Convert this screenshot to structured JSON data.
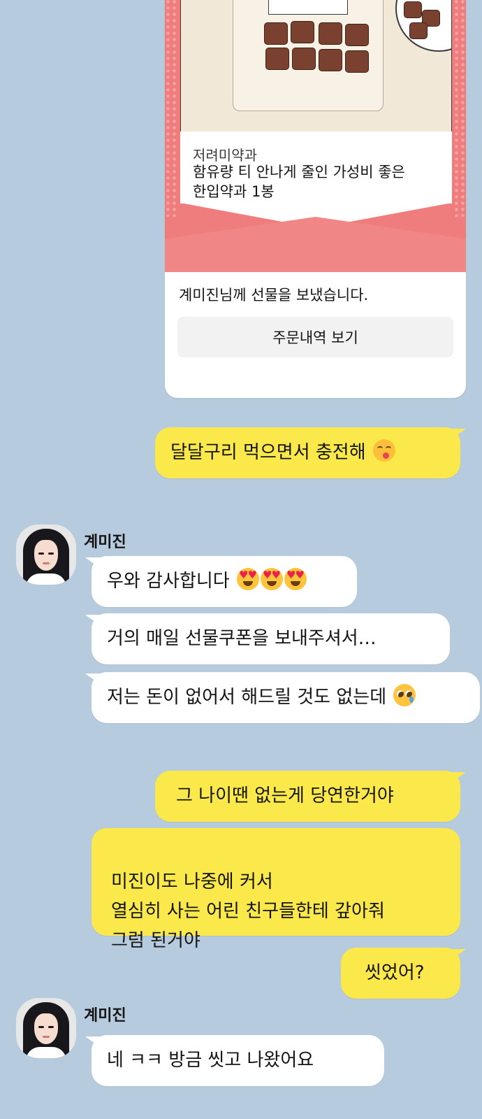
{
  "gift": {
    "product_sub": "저려미약과",
    "product_name": "함유량 티 안나게 줄인 가성비 좋은\n한입약과 1봉",
    "message": "계미진님께 선물을 보냈습니다.",
    "button_label": "주문내역 보기"
  },
  "contact": {
    "name": "계미진"
  },
  "messages": {
    "m1": "달달구리 먹으면서 충전해",
    "m2": "우와 감사합니다",
    "m3": "거의 매일  선물쿠폰을 보내주셔서…",
    "m4": "저는 돈이 없어서 해드릴 것도 없는데",
    "m5": "그 나이땐 없는게 당연한거야",
    "m6": "미진이도 나중에 커서\n열심히 사는 어린 친구들한테 갚아줘\n그럼 된거야",
    "m7": "씻었어?",
    "m8": "네 ㅋㅋ 방금 씻고 나왔어요"
  },
  "emoji": {
    "m1": "face-savoring-food",
    "m2": [
      "smiling-face-with-heart-eyes",
      "smiling-face-with-heart-eyes",
      "smiling-face-with-heart-eyes"
    ],
    "m4": "pleading-face-with-tear"
  },
  "colors": {
    "background": "#b7cbde",
    "my_bubble": "#fbe84a",
    "their_bubble": "#ffffff",
    "gift_card_accent": "#f07d7d"
  }
}
